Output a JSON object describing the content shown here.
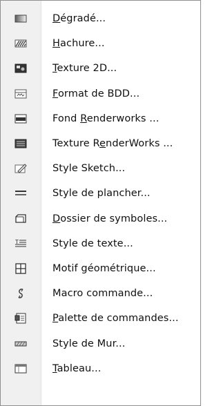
{
  "menu": {
    "items": [
      {
        "icon": "gradient-icon",
        "pre": "",
        "acc": "D",
        "post": "égradé..."
      },
      {
        "icon": "hatch-icon",
        "pre": "",
        "acc": "H",
        "post": "achure..."
      },
      {
        "icon": "texture-2d-icon",
        "pre": "",
        "acc": "T",
        "post": "exture 2D..."
      },
      {
        "icon": "database-format-icon",
        "pre": "",
        "acc": "F",
        "post": "ormat de BDD..."
      },
      {
        "icon": "renderworks-background-icon",
        "pre": "Fond ",
        "acc": "R",
        "post": "enderworks ..."
      },
      {
        "icon": "renderworks-texture-icon",
        "pre": "Texture R",
        "acc": "e",
        "post": "nderWorks ..."
      },
      {
        "icon": "sketch-style-icon",
        "pre": "Style Sketch...",
        "acc": "",
        "post": ""
      },
      {
        "icon": "floor-style-icon",
        "pre": "Style de plancher...",
        "acc": "",
        "post": ""
      },
      {
        "icon": "symbol-folder-icon",
        "pre": "",
        "acc": "D",
        "post": "ossier de symboles..."
      },
      {
        "icon": "text-style-icon",
        "pre": "Style de texte...",
        "acc": "",
        "post": ""
      },
      {
        "icon": "geometric-pattern-icon",
        "pre": "Motif géométrique...",
        "acc": "",
        "post": ""
      },
      {
        "icon": "macro-command-icon",
        "pre": "Macro commande...",
        "acc": "",
        "post": ""
      },
      {
        "icon": "command-palette-icon",
        "pre": "",
        "acc": "P",
        "post": "alette de commandes..."
      },
      {
        "icon": "wall-style-icon",
        "pre": "Style de Mur...",
        "acc": "",
        "post": ""
      },
      {
        "icon": "table-icon",
        "pre": "",
        "acc": "T",
        "post": "ableau..."
      }
    ]
  }
}
